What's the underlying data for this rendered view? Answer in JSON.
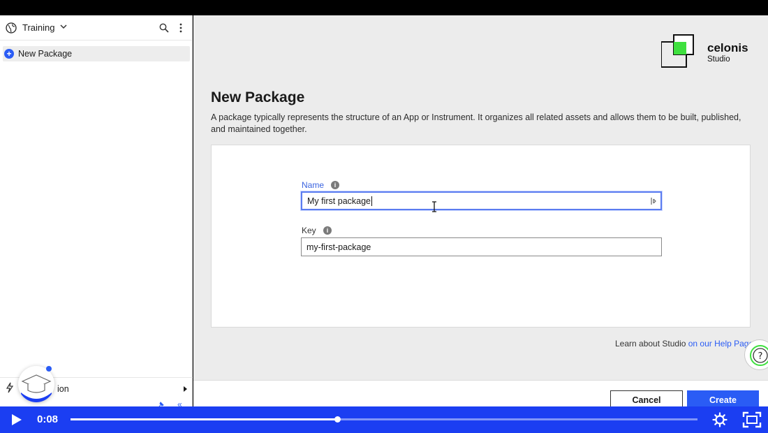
{
  "sidebar": {
    "workspace_name": "Training",
    "items": [
      {
        "label": "New Package"
      }
    ],
    "bottom_label": "ion"
  },
  "brand": {
    "name": "celonis",
    "product": "Studio"
  },
  "page": {
    "title": "New Package",
    "description": "A package typically represents the structure of an App or Instrument. It organizes all related assets and allows them to be built, published, and maintained together."
  },
  "form": {
    "name_label": "Name",
    "name_value": "My first package",
    "key_label": "Key",
    "key_value": "my-first-package"
  },
  "help": {
    "text": "Learn about Studio ",
    "link": "on our Help Page"
  },
  "actions": {
    "cancel_label": "Cancel",
    "create_label": "Create"
  },
  "player": {
    "time": "0:08",
    "progress": 0.425
  },
  "colors": {
    "accent": "#2a5cf5",
    "brand_green": "#3fe03f",
    "player_bg": "#1b3ef2"
  },
  "icons": {
    "workspace": "globe-icon",
    "search": "search-icon",
    "more": "more-vertical-icon",
    "add": "plus-icon",
    "info": "info-icon",
    "bolt": "lightning-icon",
    "help": "help-icon",
    "play": "play-icon",
    "settings": "gear-icon",
    "fullscreen": "fullscreen-icon"
  }
}
